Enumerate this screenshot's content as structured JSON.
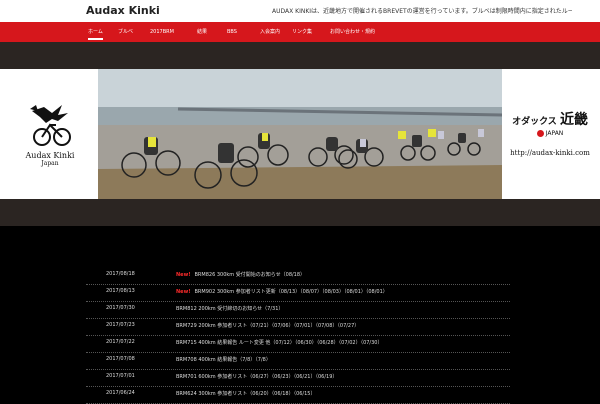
{
  "header": {
    "site_title": "Audax Kinki",
    "tagline": "AUDAX KINKIは、近畿地方で開催されるBREVETの運営を行っています。ブルベは制限時間内に指定されたルートを走るロングライドイベントです。"
  },
  "nav": {
    "items": [
      {
        "label": "ホーム",
        "active": true
      },
      {
        "label": "ブルベ"
      },
      {
        "label": "2017BRM"
      },
      {
        "label": "結果"
      },
      {
        "label": "BBS"
      },
      {
        "label": "入会案内"
      },
      {
        "label": "リンク集"
      },
      {
        "label": "お問い合わせ・規約"
      }
    ]
  },
  "hero": {
    "left_logo_name": "Audax Kinki",
    "left_logo_sub": "Japan",
    "right_logo_text": "オダックス",
    "right_logo_kanji": "近畿",
    "right_logo_japan": "JAPAN",
    "url": "http://audax-kinki.com"
  },
  "news": {
    "rows": [
      {
        "date": "2017/08/18",
        "new": "New!",
        "text": "BRM826 300km 受付開始のお知らせ（08/18）"
      },
      {
        "date": "2017/08/13",
        "new": "New!",
        "text": "BRM902 300km 参加者リスト更新（08/13）（08/07）（08/03）（08/01）（08/01）"
      },
      {
        "date": "2017/07/30",
        "new": "",
        "text": "BRM812 200km 受付締切のお知らせ（7/31）"
      },
      {
        "date": "2017/07/23",
        "new": "",
        "text": "BRM729 200km 参加者リスト（07/21）（07/06）（07/01）（07/08）（07/27）"
      },
      {
        "date": "2017/07/22",
        "new": "",
        "text": "BRM715 400km 結果報告 ルート変更 他（07/12）（06/30）（06/28）（07/02）（07/30）"
      },
      {
        "date": "2017/07/08",
        "new": "",
        "text": "BRM708 400km 結果報告（7/8）（7/8）"
      },
      {
        "date": "2017/07/01",
        "new": "",
        "text": "BRM701 600km 参加者リスト（06/27）（06/23）（06/21）（06/19）"
      },
      {
        "date": "2017/06/24",
        "new": "",
        "text": "BRM624 300km 参加者リスト（06/20）（06/18）（06/15）"
      }
    ]
  }
}
